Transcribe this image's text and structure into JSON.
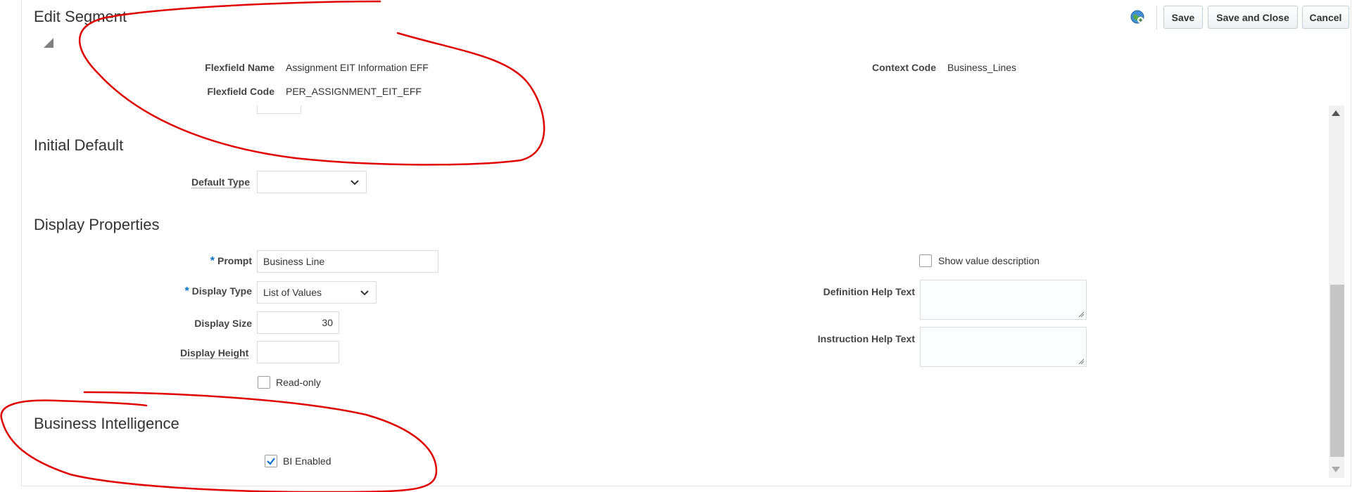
{
  "page": {
    "title": "Edit Segment"
  },
  "toolbar": {
    "save_label": "Save",
    "save_close_label": "Save and Close",
    "cancel_label": "Cancel"
  },
  "header_info": {
    "flexfield_name_label": "Flexfield Name",
    "flexfield_name_value": "Assignment EIT Information EFF",
    "flexfield_code_label": "Flexfield Code",
    "flexfield_code_value": "PER_ASSIGNMENT_EIT_EFF",
    "context_code_label": "Context Code",
    "context_code_value": "Business_Lines"
  },
  "initial_default": {
    "heading": "Initial Default",
    "default_type_label": "Default Type",
    "default_type_value": ""
  },
  "display_properties": {
    "heading": "Display Properties",
    "prompt_label": "Prompt",
    "prompt_value": "Business Line",
    "display_type_label": "Display Type",
    "display_type_value": "List of Values",
    "display_size_label": "Display Size",
    "display_size_value": "30",
    "display_height_label": "Display Height",
    "display_height_value": "",
    "read_only_label": "Read-only",
    "read_only_checked": false,
    "show_value_description_label": "Show value description",
    "show_value_description_checked": false,
    "definition_help_label": "Definition Help Text",
    "instruction_help_label": "Instruction Help Text"
  },
  "business_intelligence": {
    "heading": "Business Intelligence",
    "bi_enabled_label": "BI Enabled",
    "bi_enabled_checked": true
  },
  "colors": {
    "accent": "#0572ce",
    "annotation_red": "#e00000"
  }
}
